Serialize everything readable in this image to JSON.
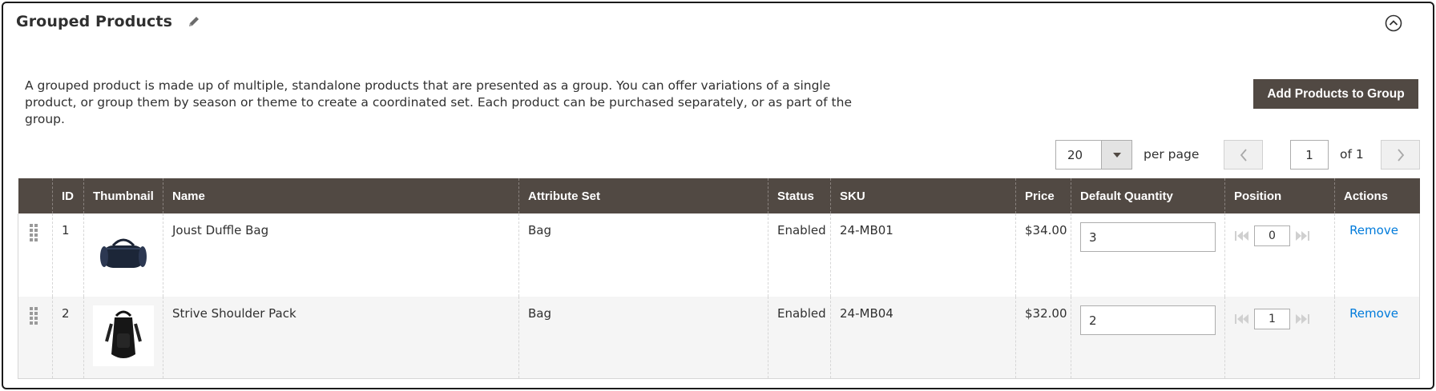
{
  "section": {
    "title": "Grouped Products",
    "description": "A grouped product is made up of multiple, standalone products that are presented as a group. You can offer variations of a single product, or group them by season or theme to create a coordinated set. Each product can be purchased separately, or as part of the group.",
    "add_button_label": "Add Products to Group"
  },
  "pager": {
    "per_page_value": "20",
    "per_page_label": "per page",
    "current_page": "1",
    "total_label": "of 1"
  },
  "grid": {
    "columns": [
      "ID",
      "Thumbnail",
      "Name",
      "Attribute Set",
      "Status",
      "SKU",
      "Price",
      "Default Quantity",
      "Position",
      "Actions"
    ],
    "rows": [
      {
        "id": "1",
        "thumbnail": "duffle-bag-thumbnail",
        "name": "Joust Duffle Bag",
        "attribute_set": "Bag",
        "status": "Enabled",
        "sku": "24-MB01",
        "price": "$34.00",
        "default_quantity": "3",
        "position": "0",
        "action": "Remove"
      },
      {
        "id": "2",
        "thumbnail": "backpack-thumbnail",
        "name": "Strive Shoulder Pack",
        "attribute_set": "Bag",
        "status": "Enabled",
        "sku": "24-MB04",
        "price": "$32.00",
        "default_quantity": "2",
        "position": "1",
        "action": "Remove"
      }
    ]
  },
  "colors": {
    "header_bg": "#514943",
    "button_bg": "#514943",
    "link": "#007bdb",
    "row_alt_bg": "#f5f5f5"
  },
  "icons": [
    "pencil-icon",
    "collapse-chevron-icon",
    "dropdown-arrow-icon",
    "chevron-left-icon",
    "chevron-right-icon",
    "drag-handle-icon",
    "skip-first-icon",
    "skip-last-icon"
  ]
}
